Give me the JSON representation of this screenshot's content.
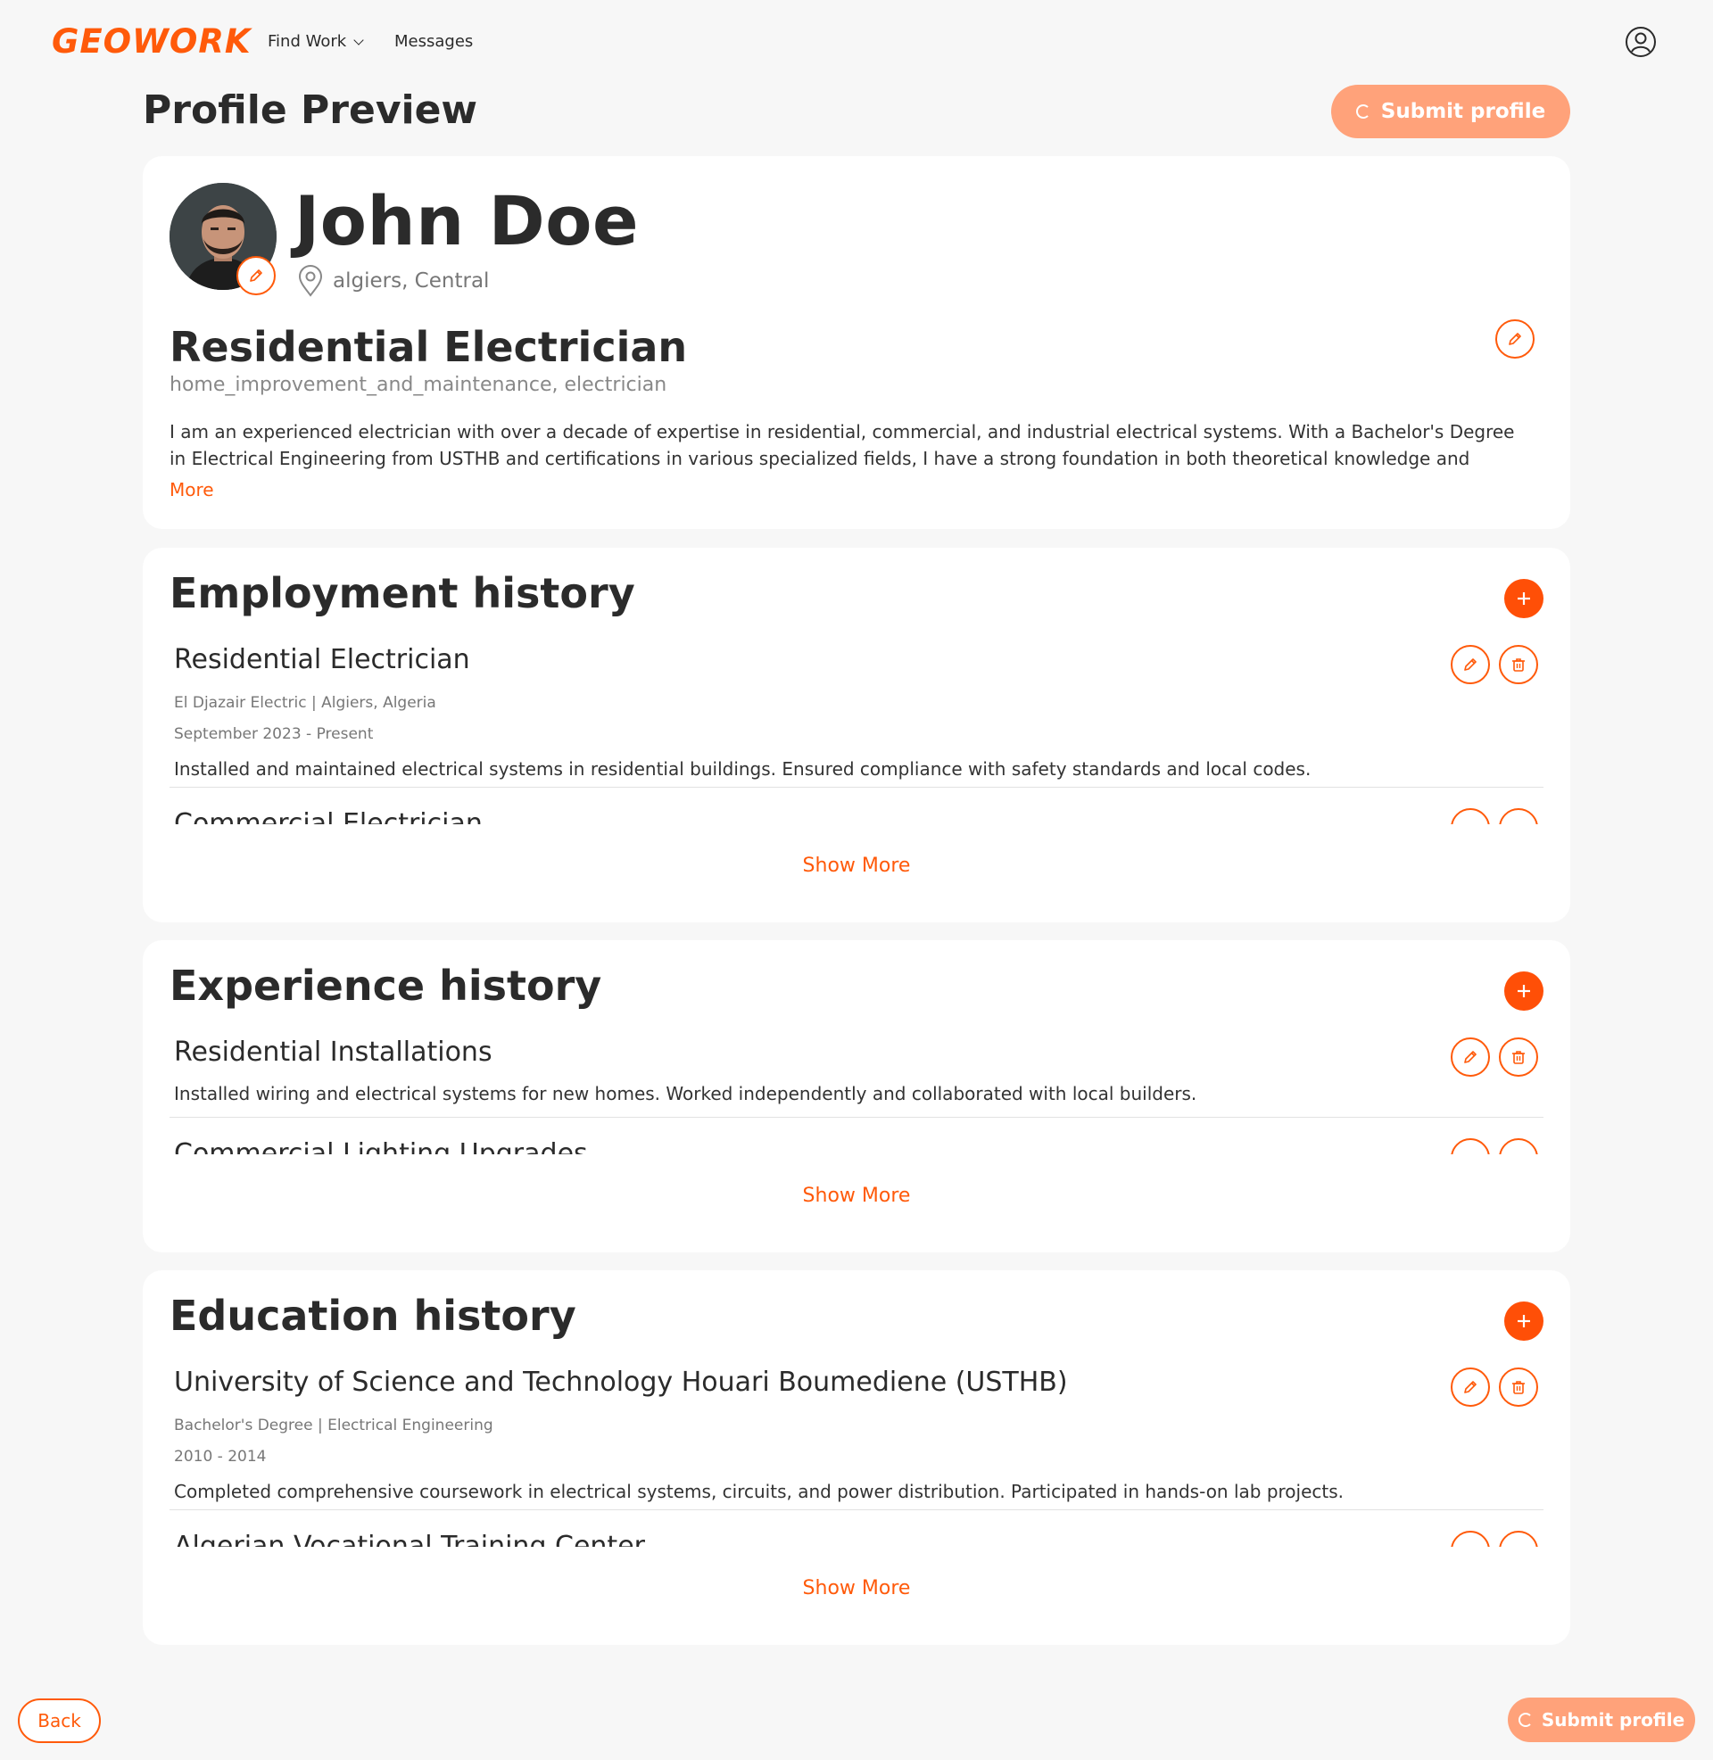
{
  "brand": {
    "logo_text": "GEOWORK",
    "accent": "#ff5a0a",
    "accent_light": "#ffa27a"
  },
  "nav": {
    "find_work": "Find Work",
    "messages": "Messages"
  },
  "header": {
    "title": "Profile Preview",
    "submit_label": "Submit profile"
  },
  "profile": {
    "name": "John Doe",
    "location": "algiers, Central",
    "job_title": "Residential Electrician",
    "categories": "home_improvement_and_maintenance, electrician",
    "bio": "I am an experienced electrician with over a decade of expertise in residential, commercial, and industrial electrical systems. With a Bachelor's Degree in Electrical Engineering from USTHB and certifications in various specialized fields, I have a strong foundation in both theoretical knowledge and practical",
    "more_label": "More"
  },
  "employment": {
    "title": "Employment history",
    "items": [
      {
        "title": "Residential Electrician",
        "company": "El Djazair Electric | Algiers, Algeria",
        "dates": "September 2023 - Present",
        "description": "Installed and maintained electrical systems in residential buildings. Ensured compliance with safety standards and local codes."
      },
      {
        "title": "Commercial Electrician"
      }
    ],
    "show_more": "Show More"
  },
  "experience": {
    "title": "Experience history",
    "items": [
      {
        "title": "Residential Installations",
        "description": "Installed wiring and electrical systems for new homes. Worked independently and collaborated with local builders."
      },
      {
        "title": "Commercial Lighting Upgrades"
      }
    ],
    "show_more": "Show More"
  },
  "education": {
    "title": "Education history",
    "items": [
      {
        "title": "University of Science and Technology Houari Boumediene (USTHB)",
        "degree": "Bachelor's Degree | Electrical Engineering",
        "dates": "2010 - 2014",
        "description": "Completed comprehensive coursework in electrical systems, circuits, and power distribution. Participated in hands-on lab projects."
      },
      {
        "title": "Algerian Vocational Training Center"
      }
    ],
    "show_more": "Show More"
  },
  "footer": {
    "back_label": "Back",
    "submit_label": "Submit profile"
  }
}
